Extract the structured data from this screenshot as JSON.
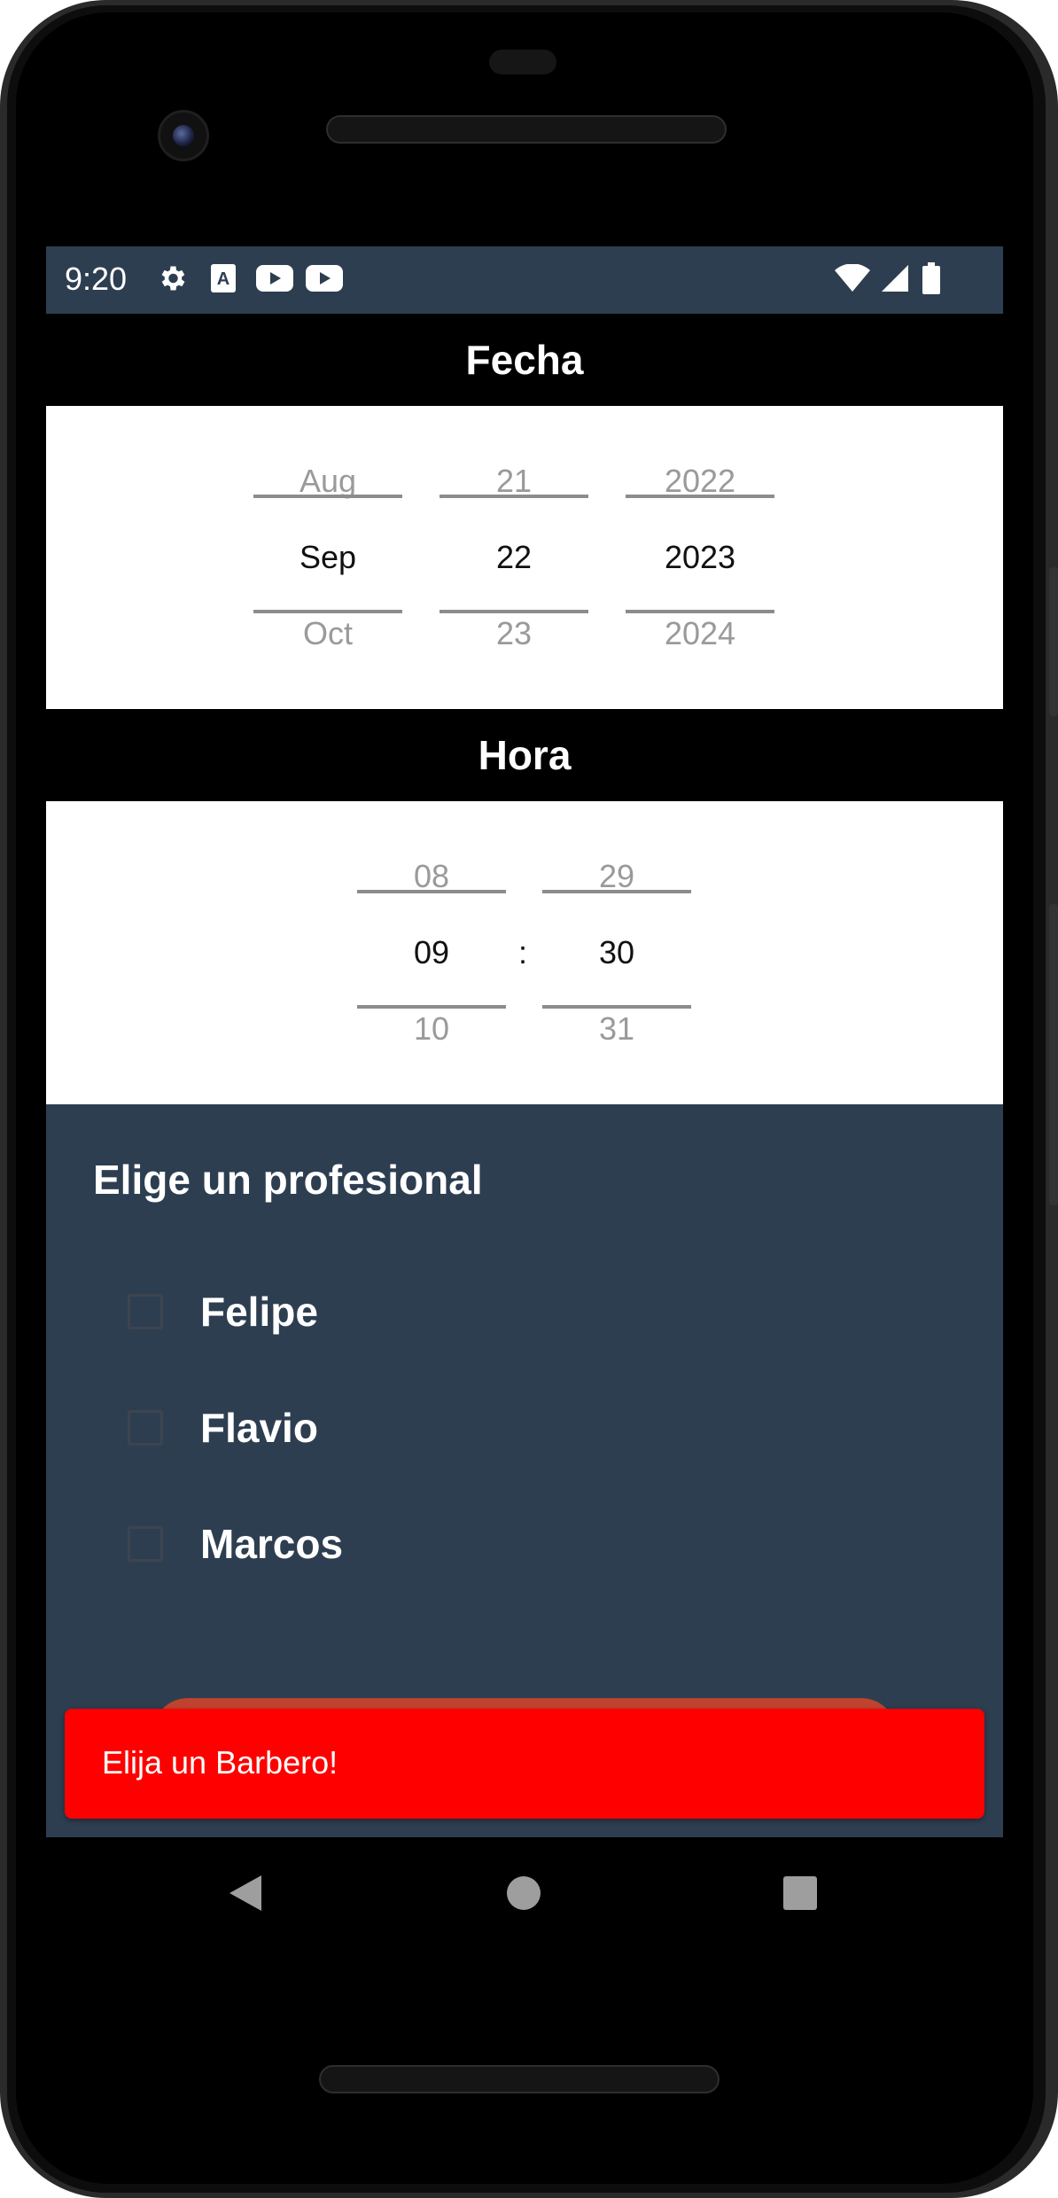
{
  "status_bar": {
    "time": "9:20",
    "left_icons": [
      "gear-icon",
      "text-a-icon",
      "youtube-icon",
      "youtube-icon"
    ],
    "right_icons": [
      "wifi-icon",
      "signal-icon",
      "battery-icon"
    ]
  },
  "date_section": {
    "header": "Fecha",
    "month": {
      "prev": "Aug",
      "current": "Sep",
      "next": "Oct"
    },
    "day": {
      "prev": "21",
      "current": "22",
      "next": "23"
    },
    "year": {
      "prev": "2022",
      "current": "2023",
      "next": "2024"
    }
  },
  "time_section": {
    "header": "Hora",
    "hour": {
      "prev": "08",
      "current": "09",
      "next": "10"
    },
    "separator": ":",
    "minute": {
      "prev": "29",
      "current": "30",
      "next": "31"
    }
  },
  "professionals": {
    "title": "Elige un profesional",
    "options": [
      {
        "label": "Felipe",
        "checked": false
      },
      {
        "label": "Flavio",
        "checked": false
      },
      {
        "label": "Marcos",
        "checked": false
      }
    ]
  },
  "snackbar": {
    "message": "Elija un Barbero!"
  },
  "nav_bar": {
    "buttons": [
      "back-icon",
      "home-icon",
      "recents-icon"
    ]
  },
  "colors": {
    "app_background": "#2e3e51",
    "header_background": "#000000",
    "snackbar_background": "#fe0000",
    "accent_button": "#c0432f"
  }
}
